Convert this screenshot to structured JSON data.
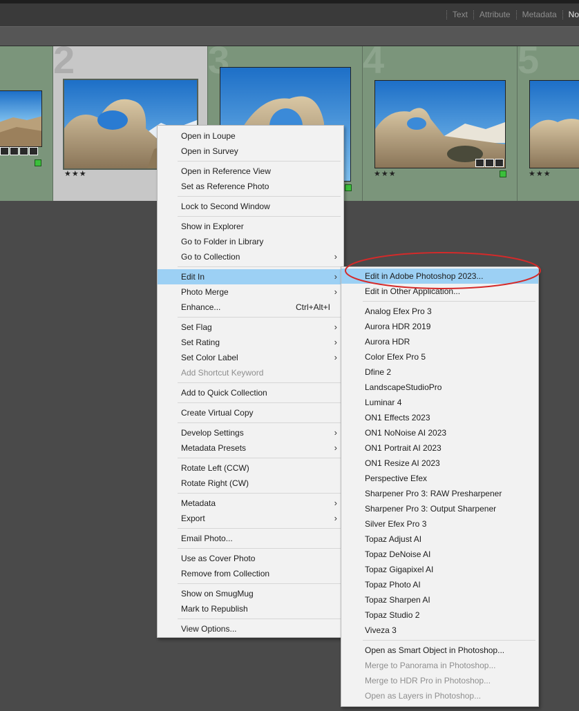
{
  "filter_bar": {
    "items": [
      {
        "label": "Text",
        "active": false
      },
      {
        "label": "Attribute",
        "active": false
      },
      {
        "label": "Metadata",
        "active": false
      },
      {
        "label": "No",
        "active": true
      }
    ]
  },
  "grid": {
    "cells": [
      {
        "number": "",
        "stars": "",
        "selected": false
      },
      {
        "number": "2",
        "stars": "★★★",
        "selected": true
      },
      {
        "number": "3",
        "stars": "",
        "selected": false
      },
      {
        "number": "4",
        "stars": "★★★",
        "selected": false
      },
      {
        "number": "5",
        "stars": "★★★",
        "selected": false
      }
    ]
  },
  "context_menu": {
    "groups": [
      [
        {
          "label": "Open in Loupe"
        },
        {
          "label": "Open in Survey"
        }
      ],
      [
        {
          "label": "Open in Reference View"
        },
        {
          "label": "Set as Reference Photo"
        }
      ],
      [
        {
          "label": "Lock to Second Window"
        }
      ],
      [
        {
          "label": "Show in Explorer"
        },
        {
          "label": "Go to Folder in Library"
        },
        {
          "label": "Go to Collection",
          "submenu": true
        }
      ],
      [
        {
          "label": "Edit In",
          "submenu": true,
          "highlighted": true
        },
        {
          "label": "Photo Merge",
          "submenu": true
        },
        {
          "label": "Enhance...",
          "shortcut": "Ctrl+Alt+I"
        }
      ],
      [
        {
          "label": "Set Flag",
          "submenu": true
        },
        {
          "label": "Set Rating",
          "submenu": true
        },
        {
          "label": "Set Color Label",
          "submenu": true
        },
        {
          "label": "Add Shortcut Keyword",
          "disabled": true
        }
      ],
      [
        {
          "label": "Add to Quick Collection"
        }
      ],
      [
        {
          "label": "Create Virtual Copy"
        }
      ],
      [
        {
          "label": "Develop Settings",
          "submenu": true
        },
        {
          "label": "Metadata Presets",
          "submenu": true
        }
      ],
      [
        {
          "label": "Rotate Left (CCW)"
        },
        {
          "label": "Rotate Right (CW)"
        }
      ],
      [
        {
          "label": "Metadata",
          "submenu": true
        },
        {
          "label": "Export",
          "submenu": true
        }
      ],
      [
        {
          "label": "Email Photo..."
        }
      ],
      [
        {
          "label": "Use as Cover Photo"
        },
        {
          "label": "Remove from Collection"
        }
      ],
      [
        {
          "label": "Show on SmugMug"
        },
        {
          "label": "Mark to Republish"
        }
      ],
      [
        {
          "label": "View Options..."
        }
      ]
    ]
  },
  "edit_in_submenu": {
    "groups": [
      [
        {
          "label": "Edit in Adobe Photoshop 2023...",
          "highlighted": true
        },
        {
          "label": "Edit in Other Application..."
        }
      ],
      [
        {
          "label": "Analog Efex Pro 3"
        },
        {
          "label": "Aurora HDR 2019"
        },
        {
          "label": "Aurora HDR"
        },
        {
          "label": "Color Efex Pro 5"
        },
        {
          "label": "Dfine 2"
        },
        {
          "label": "LandscapeStudioPro"
        },
        {
          "label": "Luminar 4"
        },
        {
          "label": "ON1 Effects 2023"
        },
        {
          "label": "ON1 NoNoise AI 2023"
        },
        {
          "label": "ON1 Portrait AI 2023"
        },
        {
          "label": "ON1 Resize AI 2023"
        },
        {
          "label": "Perspective Efex"
        },
        {
          "label": "Sharpener Pro 3: RAW Presharpener"
        },
        {
          "label": "Sharpener Pro 3: Output Sharpener"
        },
        {
          "label": "Silver Efex Pro 3"
        },
        {
          "label": "Topaz Adjust AI"
        },
        {
          "label": "Topaz DeNoise AI"
        },
        {
          "label": "Topaz Gigapixel AI"
        },
        {
          "label": "Topaz Photo AI"
        },
        {
          "label": "Topaz Sharpen AI"
        },
        {
          "label": "Topaz Studio 2"
        },
        {
          "label": "Viveza 3"
        }
      ],
      [
        {
          "label": "Open as Smart Object in Photoshop..."
        },
        {
          "label": "Merge to Panorama in Photoshop...",
          "disabled": true
        },
        {
          "label": "Merge to HDR Pro in Photoshop...",
          "disabled": true
        },
        {
          "label": "Open as Layers in Photoshop...",
          "disabled": true
        }
      ]
    ]
  },
  "colors": {
    "highlight": "#9cd0f4",
    "annotation_ellipse": "#d42a2a",
    "cell_background": "#7b957b",
    "selected_cell_background": "#c7c7c7"
  }
}
